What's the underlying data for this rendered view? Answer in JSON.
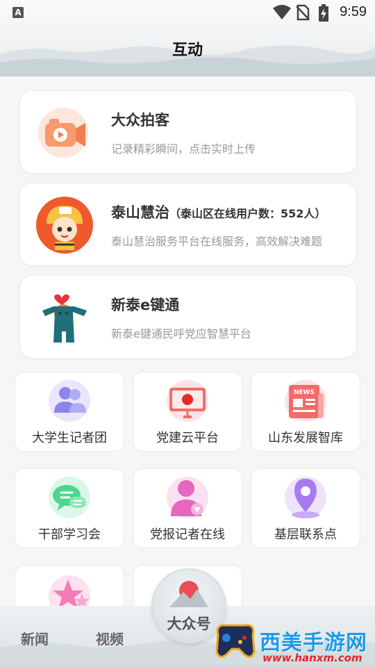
{
  "status_bar": {
    "time": "9:59",
    "badge": "A"
  },
  "header": {
    "title": "互动"
  },
  "cards": [
    {
      "title": "大众拍客",
      "subtitle": "记录精彩瞬间，点击实时上传",
      "icon": "camera-icon"
    },
    {
      "title": "泰山慧治",
      "title_note": "（泰山区在线用户数：552人）",
      "subtitle": "泰山慧治服务平台在线服务，高效解决难题",
      "icon": "mascot-icon"
    },
    {
      "title": "新泰e键通",
      "subtitle": "新泰e键通民呼党应智慧平台",
      "icon": "heart-mascot-icon"
    }
  ],
  "tiles": [
    {
      "label": "大学生记者团",
      "icon": "users-icon"
    },
    {
      "label": "党建云平台",
      "icon": "party-screen-icon"
    },
    {
      "label": "山东发展智库",
      "icon": "news-icon",
      "icon_text": "NEWS"
    },
    {
      "label": "干部学习会",
      "icon": "chat-icon"
    },
    {
      "label": "党报记者在线",
      "icon": "reporter-icon"
    },
    {
      "label": "基层联系点",
      "icon": "location-icon"
    },
    {
      "label": "",
      "icon": "star-icon"
    },
    {
      "label": "",
      "icon": "red-icon"
    }
  ],
  "bottom_nav": {
    "items": [
      "新闻",
      "视频"
    ],
    "center": "大众号"
  },
  "watermark": {
    "brand": "西美手游网",
    "url": "www.hanxm.com"
  },
  "colors": {
    "accent_orange": "#f7894a",
    "accent_purple": "#a67bf0",
    "accent_red": "#e94d57",
    "accent_green": "#4cd68c"
  }
}
